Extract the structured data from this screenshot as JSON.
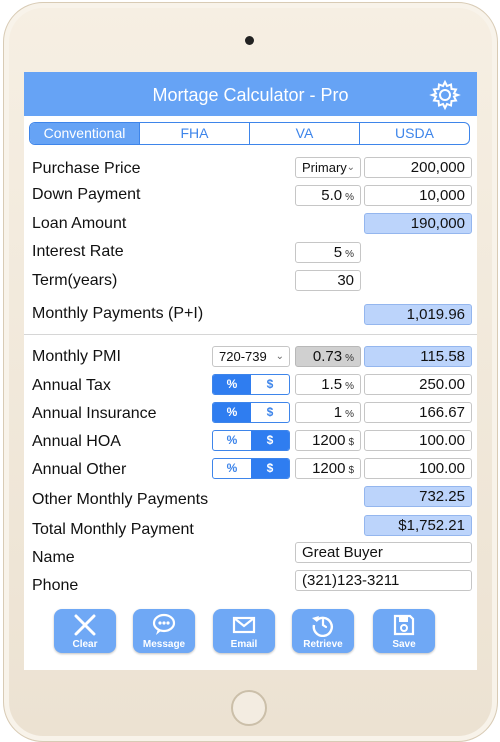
{
  "header": {
    "title": "Mortage Calculator - Pro",
    "settings_icon": "gear-icon"
  },
  "tabs": [
    {
      "label": "Conventional",
      "active": true
    },
    {
      "label": "FHA",
      "active": false
    },
    {
      "label": "VA",
      "active": false
    },
    {
      "label": "USDA",
      "active": false
    }
  ],
  "form": {
    "purchase_price": {
      "label": "Purchase Price",
      "occupancy": "Primary",
      "value": "200,000"
    },
    "down_payment": {
      "label": "Down Payment",
      "percent": "5.0",
      "unit": "%",
      "value": "10,000"
    },
    "loan_amount": {
      "label": "Loan Amount",
      "value": "190,000"
    },
    "interest_rate": {
      "label": "Interest Rate",
      "value": "5",
      "unit": "%"
    },
    "term": {
      "label": "Term(years)",
      "value": "30"
    },
    "monthly_pi": {
      "label": "Monthly Payments (P+I)",
      "value": "1,019.96"
    },
    "monthly_pmi": {
      "label": "Monthly PMI",
      "score": "720-739",
      "rate": "0.73",
      "unit": "%",
      "value": "115.58"
    },
    "annual_tax": {
      "label": "Annual Tax",
      "pct_label": "%",
      "dollar_label": "$",
      "selected": "%",
      "input": "1.5",
      "unit": "%",
      "value": "250.00"
    },
    "annual_insurance": {
      "label": "Annual Insurance",
      "pct_label": "%",
      "dollar_label": "$",
      "selected": "%",
      "input": "1",
      "unit": "%",
      "value": "166.67"
    },
    "annual_hoa": {
      "label": "Annual HOA",
      "pct_label": "%",
      "dollar_label": "$",
      "selected": "$",
      "input": "1200",
      "unit": "$",
      "value": "100.00"
    },
    "annual_other": {
      "label": "Annual Other",
      "pct_label": "%",
      "dollar_label": "$",
      "selected": "$",
      "input": "1200",
      "unit": "$",
      "value": "100.00"
    },
    "other_monthly": {
      "label": "Other Monthly Payments",
      "value": "732.25"
    },
    "total_monthly": {
      "label": "Total Monthly Payment",
      "value": "$1,752.21"
    },
    "name": {
      "label": "Name",
      "value": "Great Buyer"
    },
    "phone": {
      "label": "Phone",
      "value": "(321)123-3211"
    }
  },
  "toolbar": [
    {
      "label": "Clear",
      "icon": "close-icon"
    },
    {
      "label": "Message",
      "icon": "chat-bubble-icon"
    },
    {
      "label": "Email",
      "icon": "envelope-icon"
    },
    {
      "label": "Retrieve",
      "icon": "history-icon"
    },
    {
      "label": "Save",
      "icon": "floppy-disk-icon"
    }
  ],
  "colors": {
    "accent": "#66a3f5",
    "result_fill": "#bcd4fb",
    "toggle_on": "#2f7df0"
  }
}
